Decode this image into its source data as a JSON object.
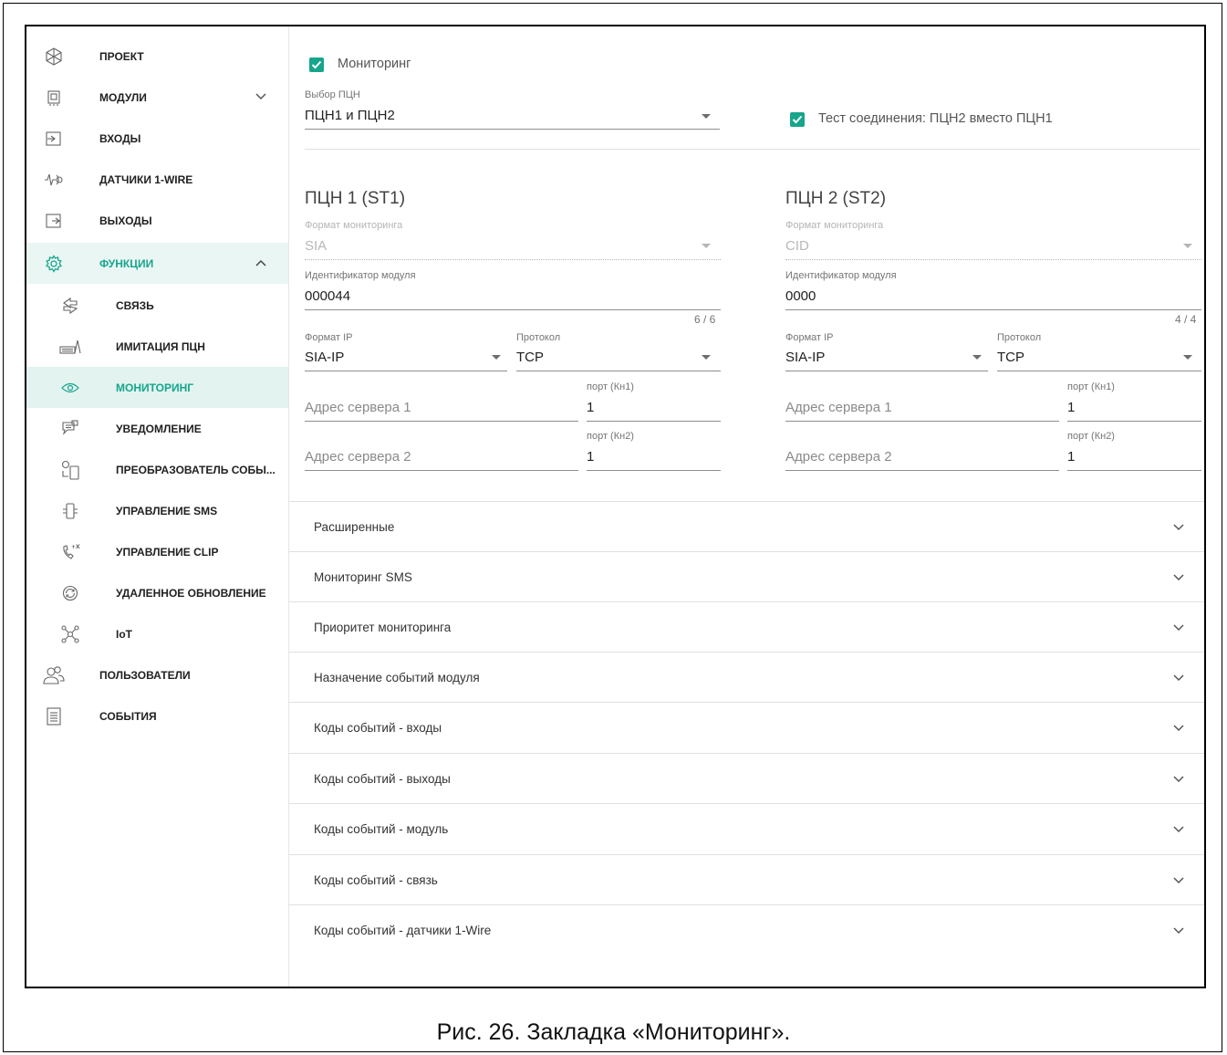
{
  "sidebar": {
    "items": [
      {
        "label": "ПРОЕКТ",
        "icon": "project-icon"
      },
      {
        "label": "МОДУЛИ",
        "icon": "module-chip-icon"
      },
      {
        "label": "ВХОДЫ",
        "icon": "inputs-icon"
      },
      {
        "label": "ДАТЧИКИ 1-WIRE",
        "icon": "sensor-1wire-icon"
      },
      {
        "label": "ВЫХОДЫ",
        "icon": "outputs-icon"
      },
      {
        "label": "ФУНКЦИИ",
        "icon": "gear-icon"
      },
      {
        "label": "СВЯЗЬ",
        "icon": "link-icon"
      },
      {
        "label": "ИМИТАЦИЯ ПЦН",
        "icon": "keyboard-icon"
      },
      {
        "label": "МОНИТОРИНГ",
        "icon": "eye-icon"
      },
      {
        "label": "УВЕДОМЛЕНИЕ",
        "icon": "notification-icon"
      },
      {
        "label": "ПРЕОБРАЗОВАТЕЛЬ СОБЫ...",
        "icon": "event-converter-icon"
      },
      {
        "label": "УПРАВЛЕНИЕ SMS",
        "icon": "sms-icon"
      },
      {
        "label": "УПРАВЛЕНИЕ CLIP",
        "icon": "clip-phone-icon"
      },
      {
        "label": "УДАЛЕННОЕ ОБНОВЛЕНИЕ",
        "icon": "refresh-icon"
      },
      {
        "label": "IoT",
        "icon": "iot-icon"
      },
      {
        "label": "ПОЛЬЗОВАТЕЛИ",
        "icon": "users-icon"
      },
      {
        "label": "СОБЫТИЯ",
        "icon": "events-list-icon"
      }
    ]
  },
  "monitoring": {
    "enabled_label": "Мониторинг",
    "station_select_label": "Выбор ПЦН",
    "station_select_value": "ПЦН1 и ПЦН2",
    "test_label": "Тест соединения: ПЦН2 вместо ПЦН1"
  },
  "stations": [
    {
      "title": "ПЦН 1 (ST1)",
      "format_label": "Формат мониторинга",
      "format_value": "SIA",
      "id_label": "Идентификатор модуля",
      "id_value": "000044",
      "id_counter": "6 / 6",
      "ipformat_label": "Формат IP",
      "ipformat_value": "SIA-IP",
      "protocol_label": "Протокол",
      "protocol_value": "TCP",
      "server1_placeholder": "Адрес сервера 1",
      "port1_label": "порт (Кн1)",
      "port1_value": "1",
      "server2_placeholder": "Адрес сервера 2",
      "port2_label": "порт (Кн2)",
      "port2_value": "1"
    },
    {
      "title": "ПЦН 2 (ST2)",
      "format_label": "Формат мониторинга",
      "format_value": "CID",
      "id_label": "Идентификатор модуля",
      "id_value": "0000",
      "id_counter": "4 / 4",
      "ipformat_label": "Формат IP",
      "ipformat_value": "SIA-IP",
      "protocol_label": "Протокол",
      "protocol_value": "TCP",
      "server1_placeholder": "Адрес сервера 1",
      "port1_label": "порт (Кн1)",
      "port1_value": "1",
      "server2_placeholder": "Адрес сервера 2",
      "port2_label": "порт (Кн2)",
      "port2_value": "1"
    }
  ],
  "accordion": [
    "Расширенные",
    "Мониторинг SMS",
    "Приоритет мониторинга",
    "Назначение событий модуля",
    "Коды событий - входы",
    "Коды событий - выходы",
    "Коды событий - модуль",
    "Коды событий - связь",
    "Коды событий - датчики 1-Wire"
  ],
  "caption": "Рис. 26. Закладка «Мониторинг».",
  "colors": {
    "accent": "#17a58c",
    "active_bg": "#e2f3f0"
  }
}
